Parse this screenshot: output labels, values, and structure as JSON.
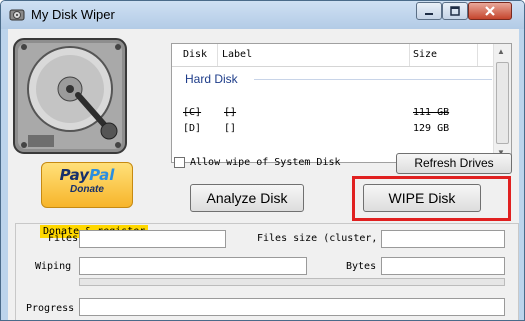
{
  "window": {
    "title": "My Disk Wiper"
  },
  "disk_list": {
    "columns": {
      "disk": "Disk",
      "label": "Label",
      "size": "Size"
    },
    "group": "Hard Disk",
    "rows": [
      {
        "disk": "[C]",
        "label": "[]",
        "size": "111 GB",
        "struck": true
      },
      {
        "disk": "[D]",
        "label": "[]",
        "size": "129 GB",
        "struck": false
      }
    ]
  },
  "paypal": {
    "pay": "Pay",
    "pal": "Pal",
    "donate": "Donate"
  },
  "donate_link": "Donate & register",
  "allow_system_wipe": {
    "label": "Allow wipe of System Disk",
    "checked": false
  },
  "buttons": {
    "refresh": "Refresh Drives",
    "analyze": "Analyze Disk",
    "wipe": "WIPE Disk"
  },
  "fields": {
    "files": "Files",
    "files_size": "Files size (cluster,",
    "wiping": "Wiping",
    "bytes": "Bytes",
    "progress": "Progress"
  },
  "colors": {
    "highlight": "#e02020",
    "donate_bg": "#ffd800",
    "group_text": "#1e3d8a"
  }
}
